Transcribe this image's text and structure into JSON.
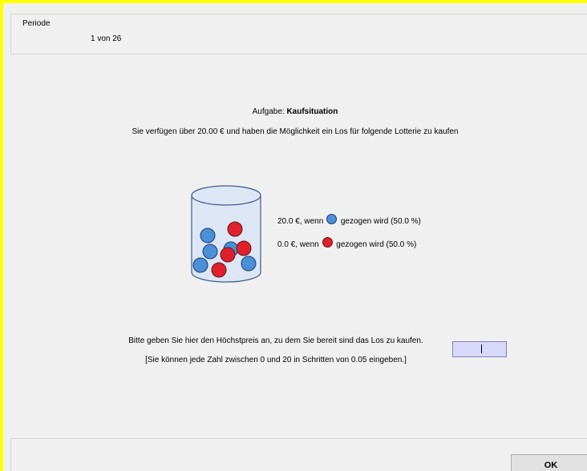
{
  "period": {
    "legend": "Periode",
    "value": "1 von 26"
  },
  "task": {
    "title_prefix": "Aufgabe: ",
    "title_bold": "Kaufsituation",
    "description": "Sie verfügen über 20.00 € und haben die Möglichkeit ein Los für folgende Lotterie zu kaufen"
  },
  "lottery": {
    "outcomes": [
      {
        "amount": "20.0 €, wenn",
        "color": "#4a90d9",
        "suffix": "gezogen wird (50.0 %)"
      },
      {
        "amount": "0.0 €, wenn",
        "color": "#e0202a",
        "suffix": "gezogen wird (50.0 %)"
      }
    ]
  },
  "instruction": "Bitte geben Sie hier den Höchstpreis an, zu dem Sie bereit sind das Los zu kaufen.",
  "hint": "[Sie können jede Zahl zwischen 0 und 20 in Schritten von 0.05 eingeben.]",
  "price_input": {
    "value": ""
  },
  "ok_button": {
    "label": "OK"
  },
  "colors": {
    "blue_ball": "#4a90d9",
    "red_ball": "#e0202a",
    "input_bg": "#d8d8f8",
    "frame": "#ffff00"
  }
}
